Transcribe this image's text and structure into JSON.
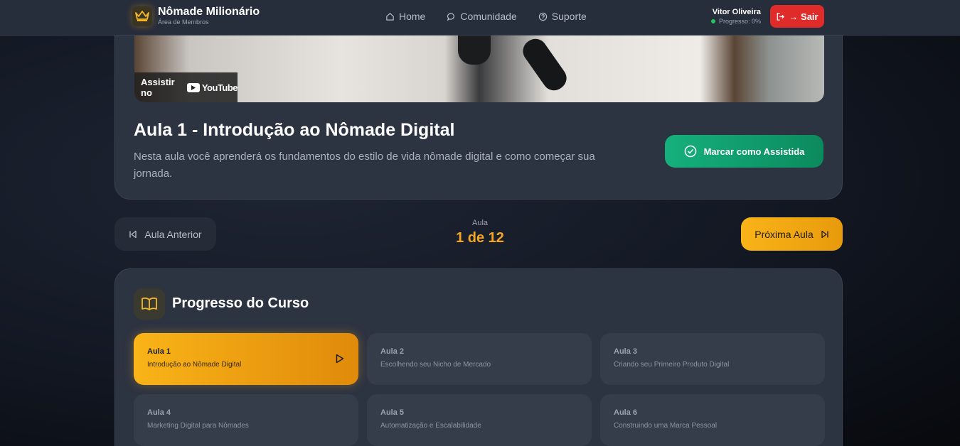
{
  "header": {
    "brand_title": "Nômade Milionário",
    "brand_subtitle": "Área de Membros",
    "nav": [
      {
        "label": "Home",
        "icon": "home-icon"
      },
      {
        "label": "Comunidade",
        "icon": "chat-icon"
      },
      {
        "label": "Suporte",
        "icon": "help-icon"
      }
    ],
    "user_name": "Vitor Oliveira",
    "user_progress": "Progresso: 0%",
    "logout_label": "→ Sair"
  },
  "video": {
    "watch_on": "Assistir no",
    "youtube": "YouTube"
  },
  "lesson": {
    "title": "Aula 1 - Introdução ao Nômade Digital",
    "description": "Nesta aula você aprenderá os fundamentos do estilo de vida nômade digital e como começar sua jornada.",
    "mark_label": "Marcar como Assistida"
  },
  "pagination": {
    "prev_label": "Aula Anterior",
    "counter_label": "Aula",
    "counter_value": "1 de 12",
    "next_label": "Próxima Aula"
  },
  "progress": {
    "title": "Progresso do Curso",
    "lessons": [
      {
        "num": "Aula 1",
        "name": "Introdução ao Nômade Digital"
      },
      {
        "num": "Aula 2",
        "name": "Escolhendo seu Nicho de Mercado"
      },
      {
        "num": "Aula 3",
        "name": "Criando seu Primeiro Produto Digital"
      },
      {
        "num": "Aula 4",
        "name": "Marketing Digital para Nômades"
      },
      {
        "num": "Aula 5",
        "name": "Automatização e Escalabilidade"
      },
      {
        "num": "Aula 6",
        "name": "Construindo uma Marca Pessoal"
      }
    ]
  },
  "colors": {
    "accent": "#f5a623",
    "success": "#16b07d",
    "danger": "#e02b2b"
  }
}
